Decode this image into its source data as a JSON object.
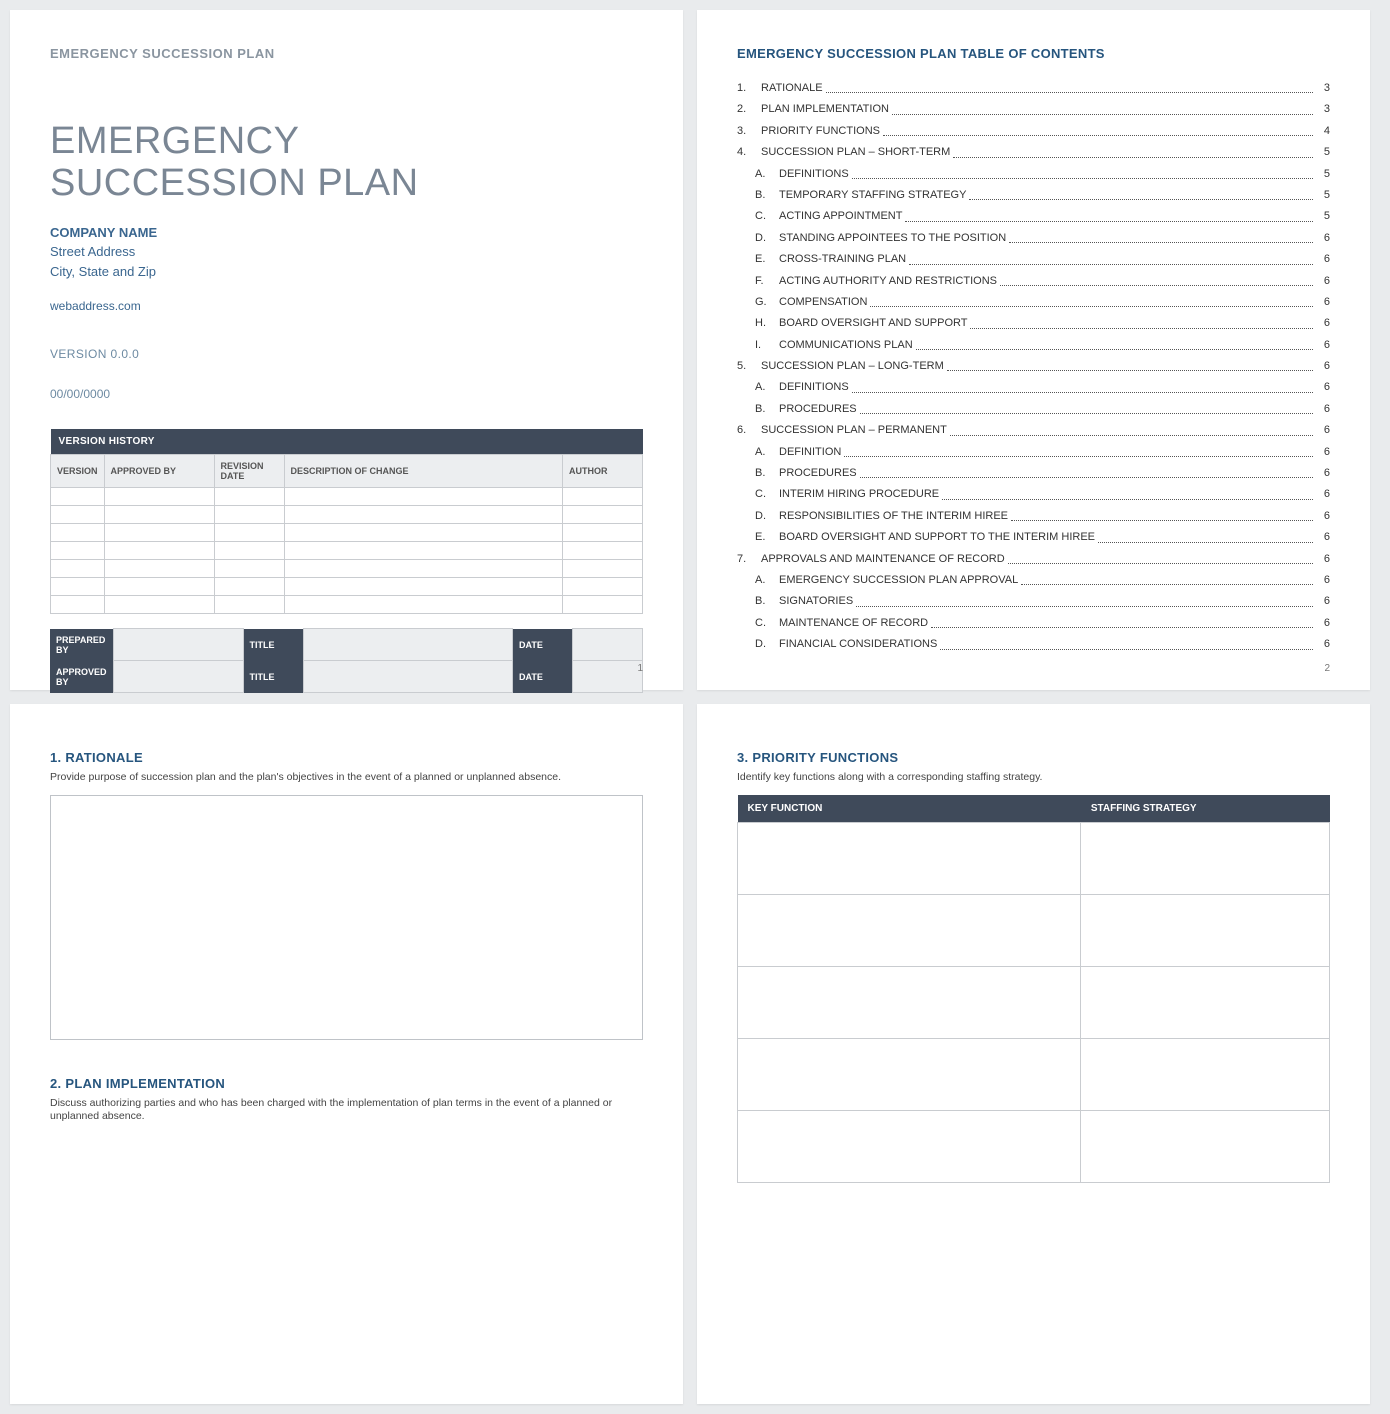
{
  "page1": {
    "header": "EMERGENCY SUCCESSION PLAN",
    "title_line1": "EMERGENCY",
    "title_line2": "SUCCESSION PLAN",
    "company": "COMPANY NAME",
    "street": "Street Address",
    "city": "City, State and Zip",
    "web": "webaddress.com",
    "version": "VERSION 0.0.0",
    "date": "00/00/0000",
    "vh_title": "VERSION HISTORY",
    "vh_cols": {
      "version": "VERSION",
      "approved_by": "APPROVED BY",
      "revision_date": "REVISION DATE",
      "description": "DESCRIPTION OF CHANGE",
      "author": "AUTHOR"
    },
    "sign": {
      "prepared_by": "PREPARED BY",
      "approved_by": "APPROVED BY",
      "title": "TITLE",
      "date": "DATE"
    },
    "pagenum": "1"
  },
  "page2": {
    "title": "EMERGENCY SUCCESSION PLAN TABLE OF CONTENTS",
    "toc": [
      {
        "n": "1.",
        "t": "RATIONALE",
        "p": "3",
        "sub": false
      },
      {
        "n": "2.",
        "t": "PLAN IMPLEMENTATION",
        "p": "3",
        "sub": false
      },
      {
        "n": "3.",
        "t": "PRIORITY FUNCTIONS",
        "p": "4",
        "sub": false
      },
      {
        "n": "4.",
        "t": "SUCCESSION PLAN – SHORT-TERM",
        "p": "5",
        "sub": false
      },
      {
        "n": "A.",
        "t": "DEFINITIONS",
        "p": "5",
        "sub": true
      },
      {
        "n": "B.",
        "t": "TEMPORARY STAFFING STRATEGY",
        "p": "5",
        "sub": true
      },
      {
        "n": "C.",
        "t": "ACTING APPOINTMENT",
        "p": "5",
        "sub": true
      },
      {
        "n": "D.",
        "t": "STANDING APPOINTEES TO THE POSITION",
        "p": "6",
        "sub": true
      },
      {
        "n": "E.",
        "t": "CROSS-TRAINING PLAN",
        "p": "6",
        "sub": true
      },
      {
        "n": "F.",
        "t": "ACTING AUTHORITY AND RESTRICTIONS",
        "p": "6",
        "sub": true
      },
      {
        "n": "G.",
        "t": " COMPENSATION",
        "p": "6",
        "sub": true
      },
      {
        "n": "H.",
        "t": "BOARD OVERSIGHT AND SUPPORT",
        "p": "6",
        "sub": true
      },
      {
        "n": "I.",
        "t": "COMMUNICATIONS PLAN",
        "p": "6",
        "sub": true
      },
      {
        "n": "5.",
        "t": "SUCCESSION PLAN – LONG-TERM",
        "p": "6",
        "sub": false
      },
      {
        "n": "A.",
        "t": "DEFINITIONS",
        "p": "6",
        "sub": true
      },
      {
        "n": "B.",
        "t": "PROCEDURES",
        "p": "6",
        "sub": true
      },
      {
        "n": "6.",
        "t": "SUCCESSION PLAN – PERMANENT",
        "p": "6",
        "sub": false
      },
      {
        "n": "A.",
        "t": "DEFINITION",
        "p": "6",
        "sub": true
      },
      {
        "n": "B.",
        "t": "PROCEDURES",
        "p": "6",
        "sub": true
      },
      {
        "n": "C.",
        "t": "INTERIM HIRING PROCEDURE",
        "p": "6",
        "sub": true
      },
      {
        "n": "D.",
        "t": "RESPONSIBILITIES OF THE INTERIM HIREE",
        "p": "6",
        "sub": true
      },
      {
        "n": "E.",
        "t": "BOARD OVERSIGHT AND SUPPORT TO THE INTERIM HIREE",
        "p": "6",
        "sub": true
      },
      {
        "n": "7.",
        "t": "APPROVALS AND MAINTENANCE OF RECORD",
        "p": "6",
        "sub": false
      },
      {
        "n": "A.",
        "t": "EMERGENCY SUCCESSION PLAN APPROVAL",
        "p": "6",
        "sub": true
      },
      {
        "n": "B.",
        "t": "SIGNATORIES",
        "p": "6",
        "sub": true
      },
      {
        "n": "C.",
        "t": "MAINTENANCE OF RECORD",
        "p": "6",
        "sub": true
      },
      {
        "n": "D.",
        "t": "FINANCIAL CONSIDERATIONS",
        "p": "6",
        "sub": true
      }
    ],
    "pagenum": "2"
  },
  "page3": {
    "s1_title": "1.  RATIONALE",
    "s1_desc": "Provide purpose of succession plan and the plan's objectives in the event of a planned or unplanned absence.",
    "s2_title": "2.  PLAN IMPLEMENTATION",
    "s2_desc": "Discuss authorizing parties and who has been charged with the implementation of plan terms in the event of a planned or unplanned absence."
  },
  "page4": {
    "s3_title": "3.  PRIORITY FUNCTIONS",
    "s3_desc": "Identify key functions along with a corresponding staffing strategy.",
    "cols": {
      "kf": "KEY FUNCTION",
      "ss": "STAFFING STRATEGY"
    }
  }
}
